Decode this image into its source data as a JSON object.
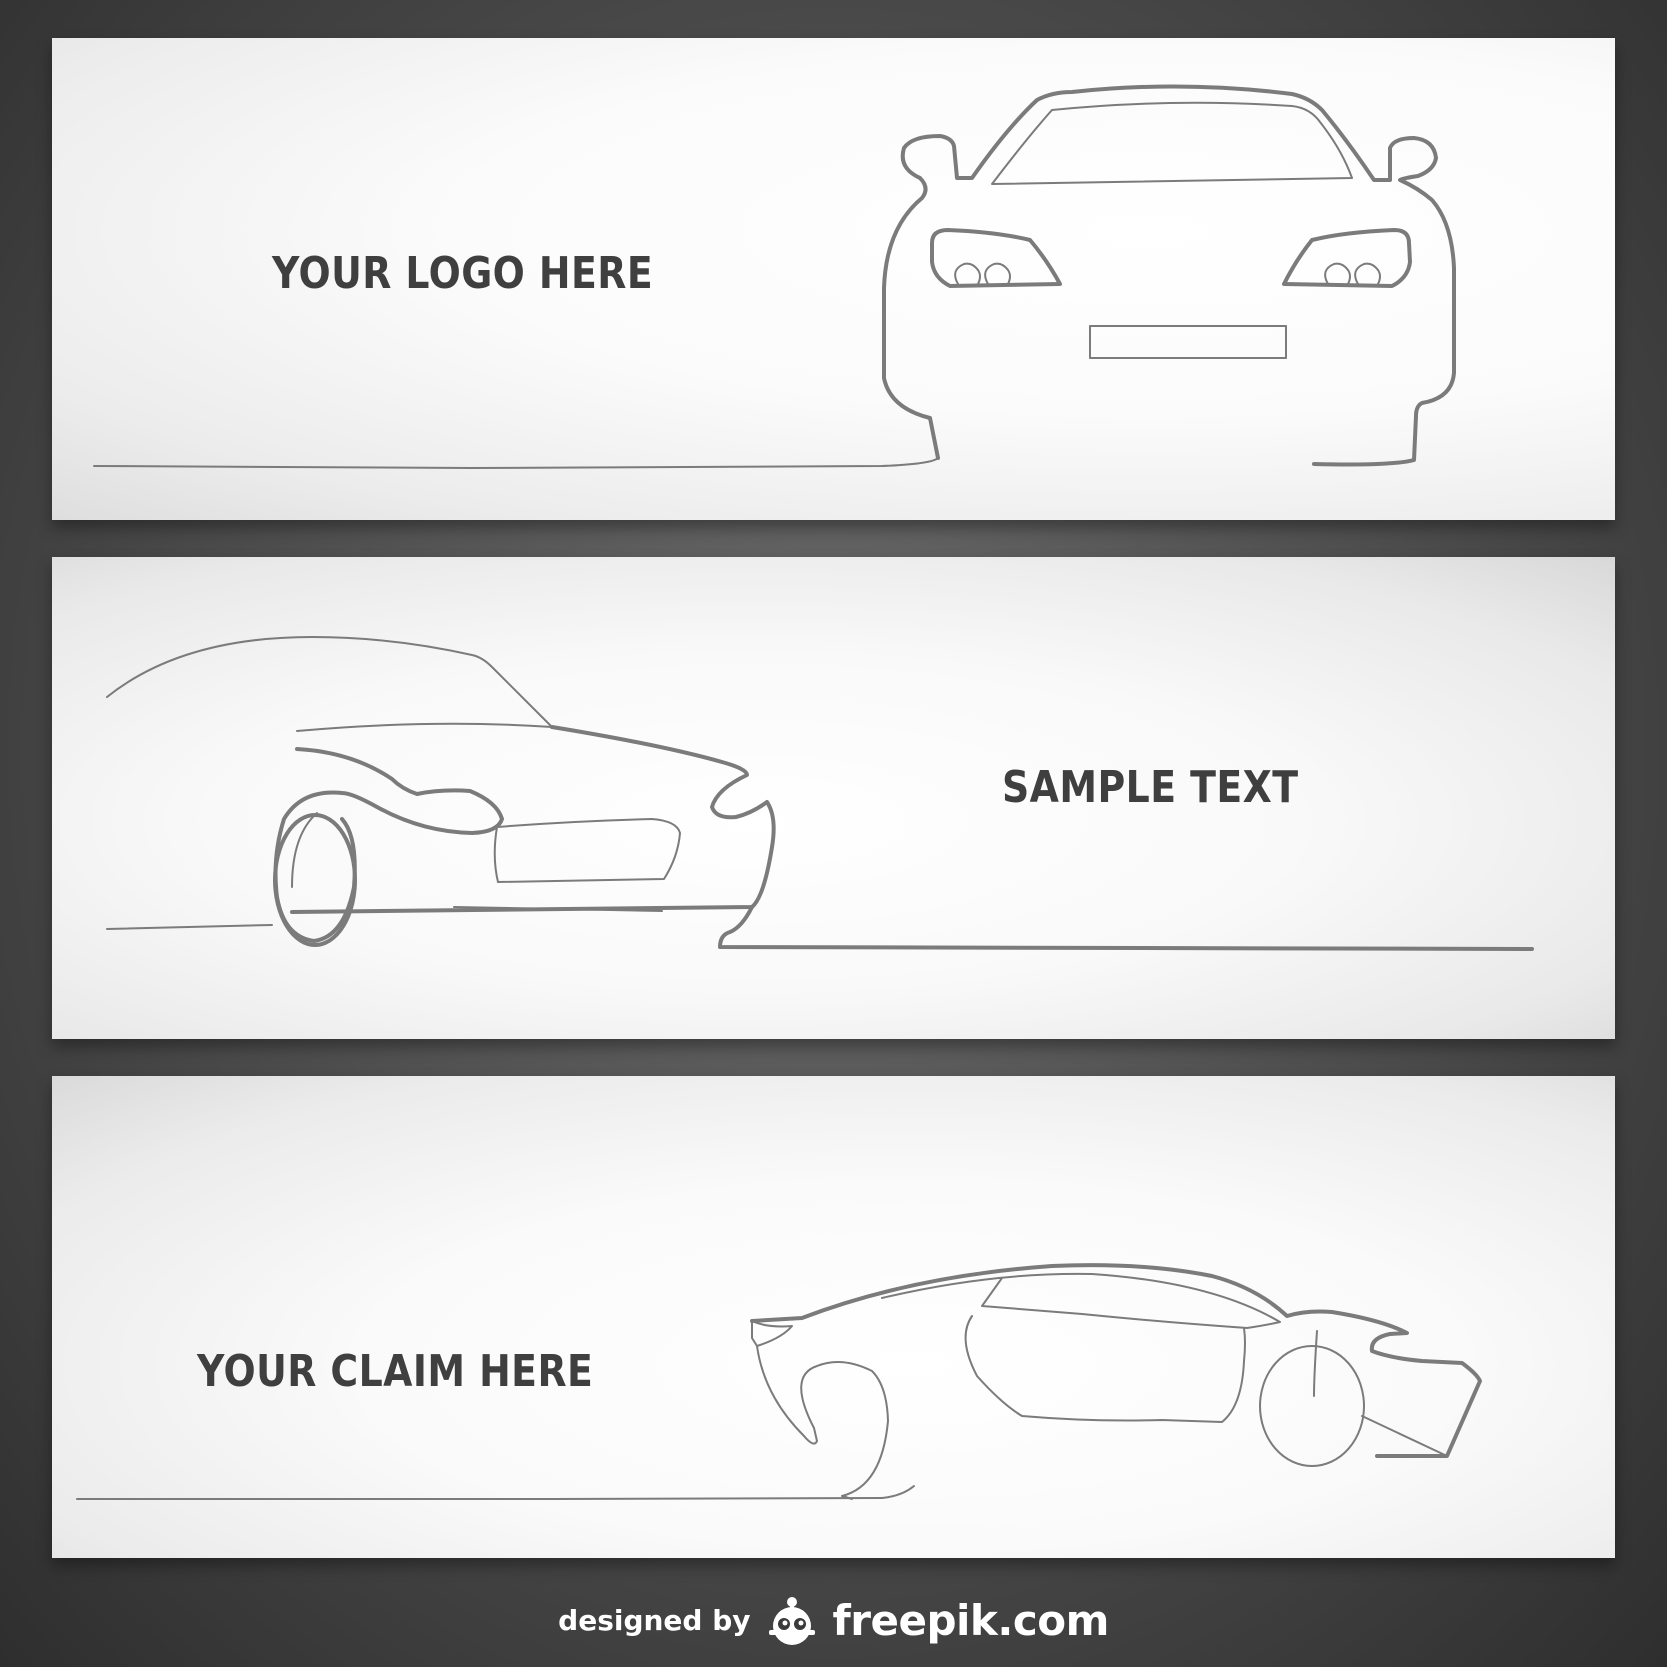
{
  "banners": [
    {
      "text": "YOUR LOGO HERE",
      "car_view": "front"
    },
    {
      "text": "SAMPLE TEXT",
      "car_view": "front-three-quarter"
    },
    {
      "text": "YOUR CLAIM HERE",
      "car_view": "side"
    }
  ],
  "credit": {
    "prefix": "designed by",
    "brand": "freepik.com",
    "icon": "freepik-logo-icon"
  },
  "colors": {
    "background": "#4a4a4a",
    "banner": "#ffffff",
    "text": "#3f3f3f",
    "stroke": "#7b7b7b"
  }
}
